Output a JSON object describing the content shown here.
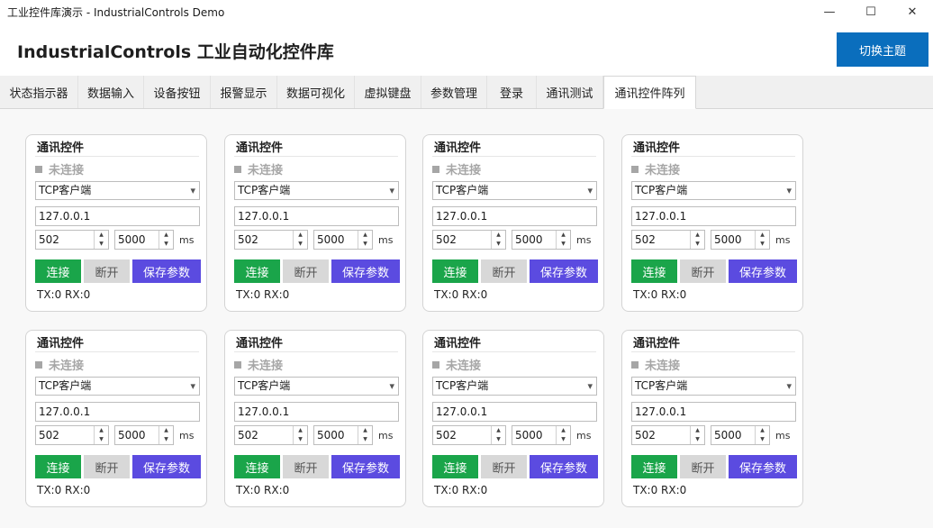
{
  "window": {
    "title": "工业控件库演示 - IndustrialControls Demo",
    "controls": [
      "—",
      "☐",
      "✕"
    ]
  },
  "header": {
    "title": "IndustrialControls 工业自动化控件库",
    "theme_button": "切换主题"
  },
  "tabs": [
    {
      "label": "状态指示器"
    },
    {
      "label": "数据输入"
    },
    {
      "label": "设备按钮"
    },
    {
      "label": "报警显示"
    },
    {
      "label": "数据可视化"
    },
    {
      "label": "虚拟键盘"
    },
    {
      "label": "参数管理"
    },
    {
      "label": "登录"
    },
    {
      "label": "通讯测试"
    },
    {
      "label": "通讯控件阵列",
      "active": true
    }
  ],
  "card": {
    "title": "通讯控件",
    "status": "未连接",
    "mode": "TCP客户端",
    "ip": "127.0.0.1",
    "port": "502",
    "timeout": "5000",
    "timeout_unit": "ms",
    "connect": "连接",
    "disconnect": "断开",
    "save": "保存参数",
    "counters": "TX:0 RX:0",
    "colors": {
      "connect": "#1aa54a",
      "disconnect": "#d8d8d8",
      "save": "#5b4be0",
      "status": "#a6a6a6"
    }
  }
}
